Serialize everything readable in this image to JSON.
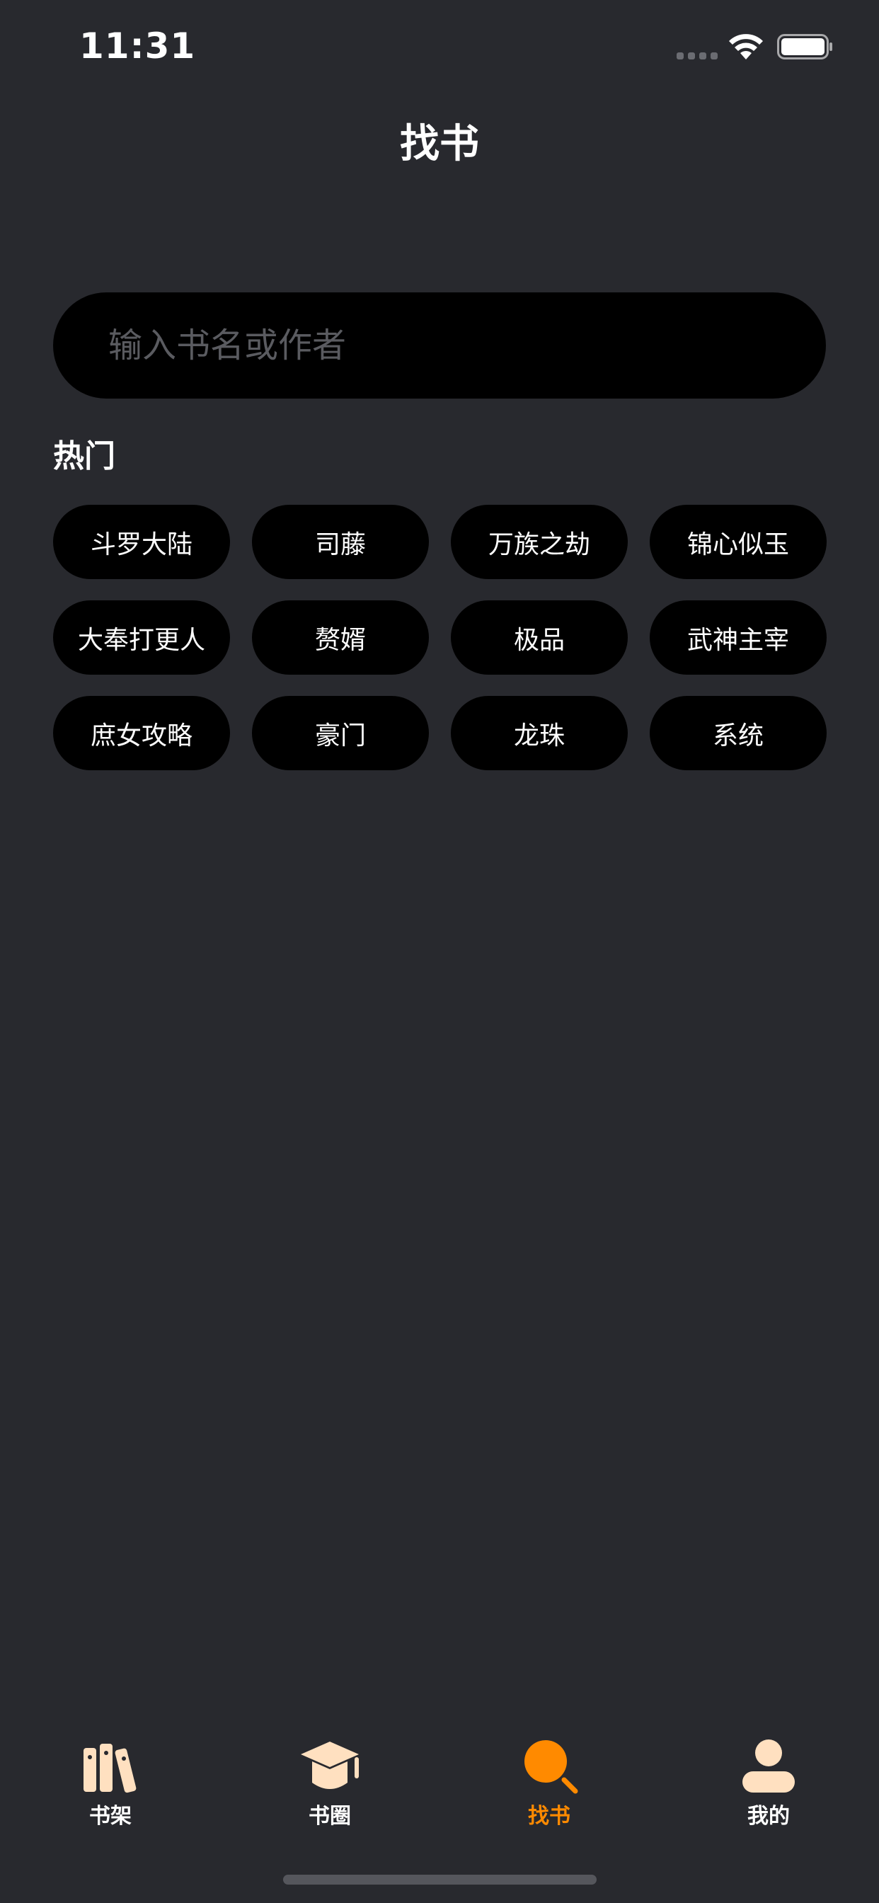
{
  "status_bar": {
    "time": "11:31"
  },
  "header": {
    "title": "找书"
  },
  "search": {
    "placeholder": "输入书名或作者",
    "value": ""
  },
  "hot": {
    "label": "热门",
    "tags": [
      "斗罗大陆",
      "司藤",
      "万族之劫",
      "锦心似玉",
      "大奉打更人",
      "赘婿",
      "极品",
      "武神主宰",
      "庶女攻略",
      "豪门",
      "龙珠",
      "系统"
    ]
  },
  "tab_bar": {
    "items": [
      {
        "label": "书架",
        "icon": "bookshelf-icon",
        "active": false
      },
      {
        "label": "书圈",
        "icon": "graduation-cap-icon",
        "active": false
      },
      {
        "label": "找书",
        "icon": "search-icon",
        "active": true
      },
      {
        "label": "我的",
        "icon": "person-icon",
        "active": false
      }
    ]
  },
  "colors": {
    "background": "#28292e",
    "accent": "#ff8a00",
    "icon_inactive": "#ffe0c0",
    "field": "#000000"
  }
}
